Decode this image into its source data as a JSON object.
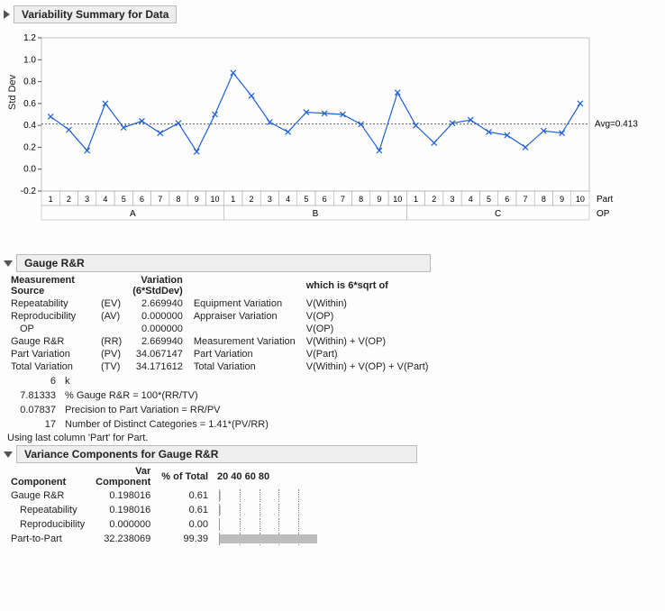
{
  "sections": {
    "variability": "Variability Summary for Data",
    "gauge": "Gauge R&R",
    "varcomp": "Variance Components for Gauge R&R"
  },
  "chart_data": {
    "type": "line",
    "ylabel": "Std Dev",
    "ylim": [
      -0.2,
      1.2
    ],
    "yticks": [
      -0.2,
      0,
      0.2,
      0.4,
      0.6,
      0.8,
      1.0,
      1.2
    ],
    "avg_label": "Avg=0.413",
    "avg_value": 0.413,
    "groups": [
      "A",
      "B",
      "C"
    ],
    "group_axis_label": "OP",
    "categories_axis_label": "Part",
    "categories": [
      "1",
      "2",
      "3",
      "4",
      "5",
      "6",
      "7",
      "8",
      "9",
      "10",
      "1",
      "2",
      "3",
      "4",
      "5",
      "6",
      "7",
      "8",
      "9",
      "10",
      "1",
      "2",
      "3",
      "4",
      "5",
      "6",
      "7",
      "8",
      "9",
      "10"
    ],
    "values": [
      0.48,
      0.36,
      0.17,
      0.6,
      0.38,
      0.44,
      0.33,
      0.42,
      0.16,
      0.5,
      0.88,
      0.67,
      0.43,
      0.34,
      0.52,
      0.51,
      0.5,
      0.41,
      0.17,
      0.7,
      0.4,
      0.24,
      0.42,
      0.45,
      0.34,
      0.31,
      0.2,
      0.35,
      0.33,
      0.6
    ]
  },
  "gauge_table": {
    "headers": {
      "source": "Measurement Source",
      "variation": "Variation (6*StdDev)",
      "which": "which is 6*sqrt of"
    },
    "rows": [
      {
        "src": "Repeatability",
        "code": "(EV)",
        "val": "2.669940",
        "desc": "Equipment Variation",
        "form": "V(Within)"
      },
      {
        "src": "Reproducibility",
        "code": "(AV)",
        "val": "0.000000",
        "desc": "Appraiser Variation",
        "form": "V(OP)"
      },
      {
        "src": "OP",
        "code": "",
        "val": "0.000000",
        "desc": "",
        "form": "V(OP)",
        "indent": true
      },
      {
        "src": "Gauge R&R",
        "code": "(RR)",
        "val": "2.669940",
        "desc": "Measurement Variation",
        "form": "V(Within) + V(OP)"
      },
      {
        "src": "Part Variation",
        "code": "(PV)",
        "val": "34.067147",
        "desc": "Part Variation",
        "form": "V(Part)"
      },
      {
        "src": "Total Variation",
        "code": "(TV)",
        "val": "34.171612",
        "desc": "Total Variation",
        "form": "V(Within) + V(OP)  + V(Part)"
      }
    ]
  },
  "gauge_details": [
    {
      "v": "6",
      "t": "k"
    },
    {
      "v": "7.81333",
      "t": "% Gauge R&R = 100*(RR/TV)"
    },
    {
      "v": "0.07837",
      "t": "Precision to Part Variation = RR/PV"
    },
    {
      "v": "17",
      "t": "Number of Distinct Categories = 1.41*(PV/RR)"
    }
  ],
  "gauge_note": "Using last column 'Part' for Part.",
  "varcomp_table": {
    "headers": {
      "comp": "Component",
      "var": "Var Component",
      "pct": "% of Total",
      "ticks": [
        "20",
        "40",
        "60",
        "80"
      ]
    },
    "rows": [
      {
        "c": "Gauge R&R",
        "v": "0.198016",
        "p": "0.61",
        "pct": 0.61
      },
      {
        "c": "Repeatability",
        "v": "0.198016",
        "p": "0.61",
        "pct": 0.61,
        "indent": true
      },
      {
        "c": "Reproducibility",
        "v": "0.000000",
        "p": "0.00",
        "pct": 0.0,
        "indent": true
      },
      {
        "c": "Part-to-Part",
        "v": "32.238069",
        "p": "99.39",
        "pct": 99.39
      }
    ]
  }
}
